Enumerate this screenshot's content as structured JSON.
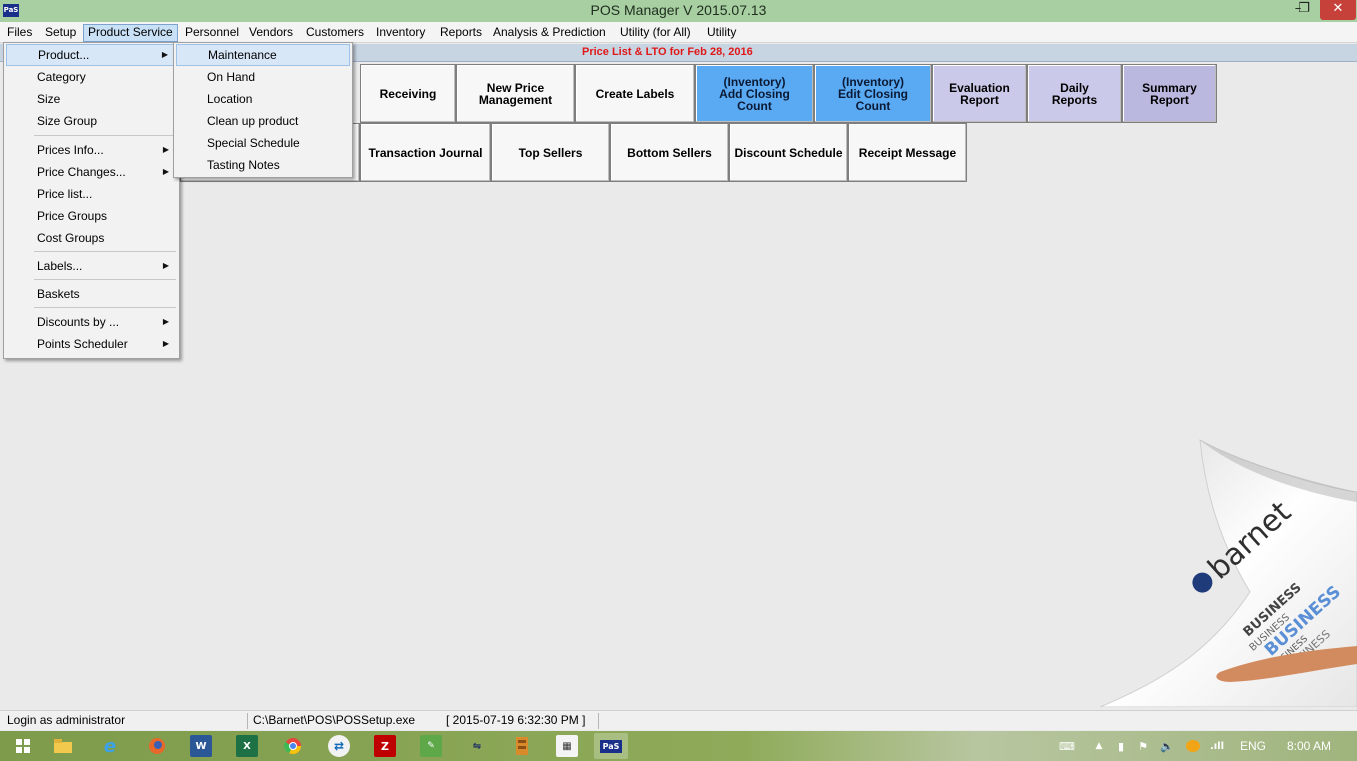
{
  "window": {
    "title": "POS Manager V 2015.07.13",
    "app_icon_text": "PaS",
    "minimize": "–",
    "maximize": "❐",
    "close": "✕"
  },
  "menubar": {
    "items": [
      "Files",
      "Setup",
      "Product Service",
      "Personnel",
      "Vendors",
      "Customers",
      "Inventory",
      "Reports",
      "Analysis & Prediction",
      "Utility (for All)",
      "Utility"
    ],
    "active": "Product Service"
  },
  "price_strip": "Price List & LTO for  Feb 28, 2016",
  "buttons_row1": [
    {
      "label": "Receiving"
    },
    {
      "label": "New Price\nManagement"
    },
    {
      "label": "Create Labels"
    },
    {
      "label": "(Inventory)\nAdd Closing\nCount"
    },
    {
      "label": "(Inventory)\nEdit Closing\nCount"
    },
    {
      "label": "Evaluation\nReport"
    },
    {
      "label": "Daily\nReports"
    },
    {
      "label": "Summary\nReport"
    }
  ],
  "buttons_row2": [
    {
      "label": "Transaction Journal"
    },
    {
      "label": "Top Sellers"
    },
    {
      "label": "Bottom Sellers"
    },
    {
      "label": "Discount Schedule"
    },
    {
      "label": "Receipt Message"
    }
  ],
  "colors": {
    "title_bar": "#a7cfa1",
    "price_text": "#e01818",
    "inventory_button": "#5aa9f3",
    "report_button": "#cbc9e9",
    "close_button": "#c7413b"
  },
  "product_service_menu": [
    {
      "label": "Product...",
      "submenu": true
    },
    {
      "label": "Category"
    },
    {
      "label": "Size"
    },
    {
      "label": "Size Group"
    },
    {
      "label": "Prices Info...",
      "submenu": true
    },
    {
      "label": "Price Changes...",
      "submenu": true
    },
    {
      "label": "Price list..."
    },
    {
      "label": "Price Groups"
    },
    {
      "label": "Cost Groups"
    },
    {
      "label": "Labels...",
      "submenu": true
    },
    {
      "label": "Baskets"
    },
    {
      "label": "Discounts by ...",
      "submenu": true
    },
    {
      "label": "Points Scheduler",
      "submenu": true
    }
  ],
  "product_submenu": [
    "Maintenance",
    "On Hand",
    "Location",
    "Clean up product",
    "Special Schedule",
    "Tasting Notes"
  ],
  "logo": {
    "brand": "barnet",
    "tagline": "BUSINESS"
  },
  "statusbar": {
    "login": "Login as administrator",
    "path": "C:\\Barnet\\POS\\POSSetup.exe",
    "timestamp": "[ 2015-07-19 6:32:30 PM ]"
  },
  "taskbar": {
    "apps": [
      "start-icon",
      "file-explorer-icon",
      "internet-explorer-icon",
      "firefox-icon",
      "word-icon",
      "excel-icon",
      "chrome-icon",
      "teamviewer-icon",
      "filezilla-icon",
      "notepad-icon",
      "network-icon",
      "archive-icon",
      "calculator-icon",
      "pos-icon"
    ],
    "pos_label": "PaS",
    "language": "ENG",
    "time": "8:00 AM"
  }
}
